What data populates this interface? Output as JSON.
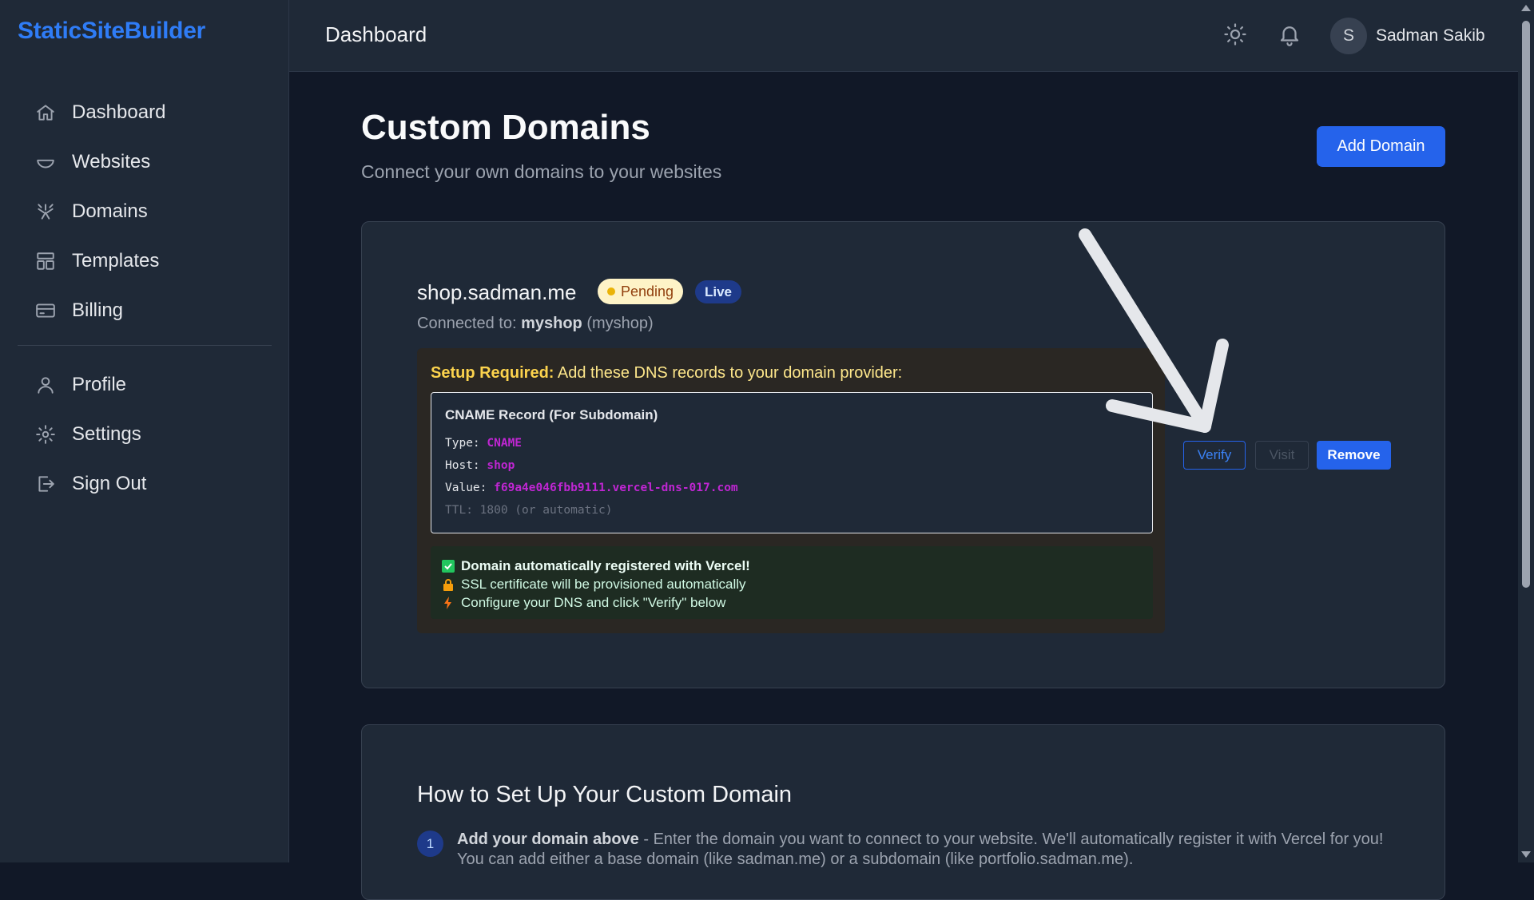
{
  "brand": "StaticSiteBuilder",
  "sidebar": {
    "items": [
      {
        "label": "Dashboard",
        "icon": "home-icon"
      },
      {
        "label": "Websites",
        "icon": "bowl-icon"
      },
      {
        "label": "Domains",
        "icon": "sparkle-icon"
      },
      {
        "label": "Templates",
        "icon": "layout-icon"
      },
      {
        "label": "Billing",
        "icon": "credit-card-icon"
      }
    ],
    "secondary": [
      {
        "label": "Profile",
        "icon": "user-icon"
      },
      {
        "label": "Settings",
        "icon": "gear-icon"
      },
      {
        "label": "Sign Out",
        "icon": "sign-out-icon"
      }
    ]
  },
  "header": {
    "title": "Dashboard",
    "avatar_initial": "S",
    "user_name": "Sadman Sakib"
  },
  "main": {
    "title": "Custom Domains",
    "subtitle": "Connect your own domains to your websites",
    "add_button": "Add Domain"
  },
  "domain_card": {
    "domain": "shop.sadman.me",
    "status_badge": "Pending",
    "live_badge": "Live",
    "connected_prefix": "Connected to:",
    "connected_site": "myshop",
    "connected_slug": "(myshop)",
    "setup_label": "Setup Required:",
    "setup_text": "Add these DNS records to your domain provider:",
    "record": {
      "title": "CNAME Record (For Subdomain)",
      "type_label": "Type:",
      "type_value": "CNAME",
      "host_label": "Host:",
      "host_value": "shop",
      "value_label": "Value:",
      "value_value": "f69a4e046fbb9111.vercel-dns-017.com",
      "ttl": "TTL: 1800 (or automatic)"
    },
    "info": {
      "registered": "Domain automatically registered with Vercel!",
      "ssl": "SSL certificate will be provisioned automatically",
      "configure": "Configure your DNS and click \"Verify\" below"
    },
    "buttons": {
      "verify": "Verify",
      "visit": "Visit",
      "remove": "Remove"
    }
  },
  "howto": {
    "title": "How to Set Up Your Custom Domain",
    "step1_num": "1",
    "step1_bold": "Add your domain above",
    "step1_text": " - Enter the domain you want to connect to your website. We'll automatically register it with Vercel for you! You can add either a base domain (like sadman.me) or a subdomain (like portfolio.sadman.me)."
  },
  "colors": {
    "accent": "#2563eb",
    "brand": "#2f7cf6",
    "background": "#111827",
    "panel": "#1f2937",
    "pending": "#fef3c7"
  }
}
